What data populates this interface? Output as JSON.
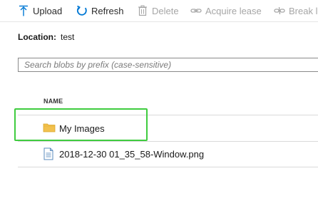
{
  "toolbar": {
    "upload_label": "Upload",
    "refresh_label": "Refresh",
    "delete_label": "Delete",
    "acquire_lease_label": "Acquire lease",
    "break_lease_label": "Break l"
  },
  "location": {
    "label": "Location:",
    "value": "test"
  },
  "search": {
    "placeholder": "Search blobs by prefix (case-sensitive)",
    "value": ""
  },
  "table": {
    "column_header": "NAME",
    "rows": [
      {
        "name": "My Images",
        "type": "folder",
        "icon": "folder-icon"
      },
      {
        "name": "2018-12-30 01_35_58-Window.png",
        "type": "file",
        "icon": "file-icon"
      }
    ]
  },
  "colors": {
    "accent": "#0078d4",
    "highlight": "#3fcc3f",
    "folder": "#f2c14e",
    "disabled": "#a6a6a6"
  }
}
